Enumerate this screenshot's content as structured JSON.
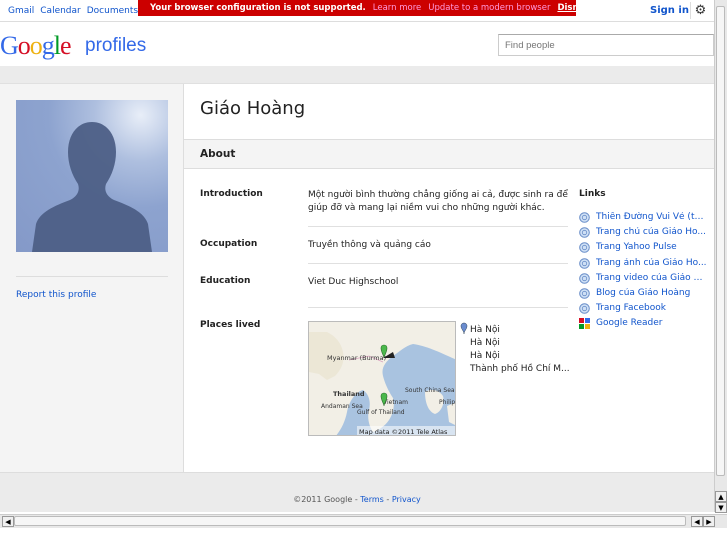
{
  "topnav": [
    "Gmail",
    "Calendar",
    "Documents"
  ],
  "warning": {
    "text": "Your browser configuration is not supported.",
    "learn_more": "Learn more",
    "update": "Update to a modern browser",
    "dismiss": "Dismiss"
  },
  "signin": "Sign in",
  "logo": {
    "g1": "G",
    "o1": "o",
    "o2": "o",
    "g2": "g",
    "l": "l",
    "e": "e",
    "profiles": "profiles"
  },
  "search": {
    "placeholder": "Find people"
  },
  "profile": {
    "name": "Giáo Hoàng",
    "report": "Report this profile"
  },
  "about": {
    "title": "About",
    "introduction_label": "Introduction",
    "introduction": "Một người bình thường chẳng giống ai cả, được sinh ra để giúp đỡ và mang lại niềm vui cho những người khác.",
    "occupation_label": "Occupation",
    "occupation": "Truyền thông và quảng cáo",
    "education_label": "Education",
    "education": "Viet Duc Highschool",
    "places_label": "Places lived"
  },
  "map": {
    "labels": [
      "Myanmar (Burma)",
      "Thailand",
      "South China Sea",
      "Andaman Sea",
      "Gulf of Thailand",
      "Vietnam",
      "Philip"
    ],
    "credit": "Map data ©2011 Tele Atlas"
  },
  "places": [
    "Hà Nội",
    "Hà Nội",
    "Hà Nội",
    "Thành phố Hồ Chí M..."
  ],
  "links": {
    "title": "Links",
    "items": [
      {
        "label": "Thiên Đường Vui Vẻ (tu...",
        "icon": "globe-icon"
      },
      {
        "label": "Trang chủ của Giáo Ho...",
        "icon": "globe-icon"
      },
      {
        "label": "Trang Yahoo Pulse",
        "icon": "globe-icon"
      },
      {
        "label": "Trang ảnh của Giáo Ho...",
        "icon": "globe-icon"
      },
      {
        "label": "Trang video của Giáo H...",
        "icon": "globe-icon"
      },
      {
        "label": "Blog của Giáo Hoàng",
        "icon": "globe-icon"
      },
      {
        "label": "Trang Facebook",
        "icon": "globe-icon"
      },
      {
        "label": "Google Reader",
        "icon": "google-reader-icon"
      }
    ]
  },
  "footer": {
    "copyright": "©2011 Google - ",
    "terms": "Terms",
    "dash": " - ",
    "privacy": "Privacy"
  },
  "colors": {
    "warning": "#cc0000",
    "link": "#1155cc",
    "brand_blue": "#3369e8"
  }
}
